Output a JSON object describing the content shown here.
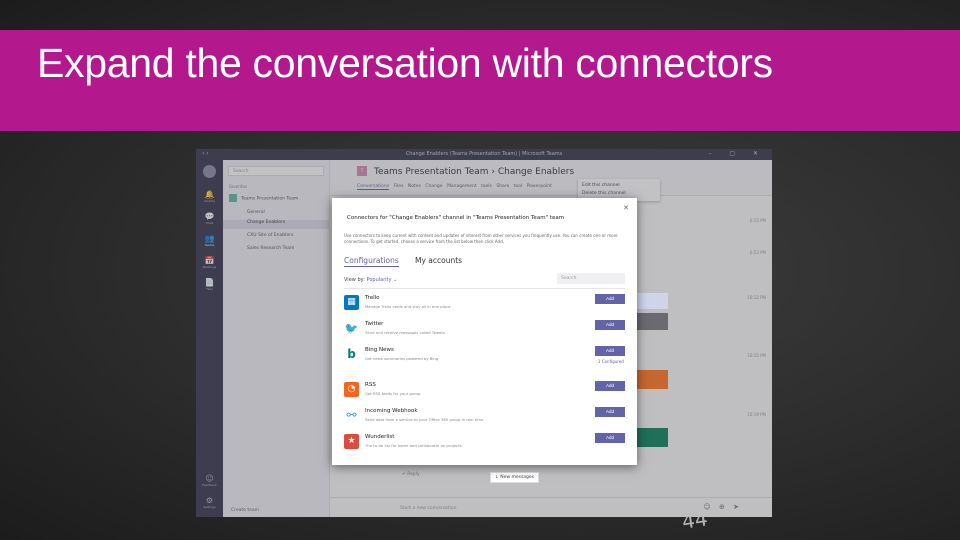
{
  "slide": {
    "title": "Expand the conversation with connectors",
    "chalk_number": "44"
  },
  "window": {
    "title": "Change Enablers (Teams Presentation Team) | Microsoft Teams",
    "nav_glyphs": "‹ ›",
    "controls": "– ▢ ✕"
  },
  "rail": [
    {
      "label": "Activity",
      "icon": "bell-icon",
      "glyph": "🔔"
    },
    {
      "label": "Chat",
      "icon": "chat-icon",
      "glyph": "💬"
    },
    {
      "label": "Teams",
      "icon": "teams-icon",
      "glyph": "👥"
    },
    {
      "label": "Meetings",
      "icon": "calendar-icon",
      "glyph": "📅"
    },
    {
      "label": "Files",
      "icon": "files-icon",
      "glyph": "📄"
    },
    {
      "label": "Feedback",
      "icon": "feedback-icon",
      "glyph": "☺"
    },
    {
      "label": "Settings",
      "icon": "settings-icon",
      "glyph": "⚙"
    }
  ],
  "left_pane": {
    "search_placeholder": "Search",
    "favorites_label": "Favorites",
    "team_name": "Teams Presentation Team",
    "channels": [
      "General",
      "Change Enablers",
      "CXU Site of Enablers",
      "Sales Research Team"
    ],
    "create_team": "Create team"
  },
  "channel": {
    "avatar": "T",
    "breadcrumb": "Teams Presentation Team › Change Enablers",
    "tabs": [
      "Conversations",
      "Files",
      "Notes",
      "Change Management tools",
      "Share tool",
      "Powerpoint"
    ],
    "menu": [
      "Edit this channel",
      "Delete this channel"
    ],
    "timestamps": [
      "6:15 PM",
      "6:53 PM",
      "10:12 PM",
      "10:15 PM",
      "10:19 PM"
    ],
    "reply": "↵ Reply",
    "new_messages": "↓ New messages",
    "composer_placeholder": "Start a new conversation",
    "composer_icons": "☺ ⊕ ➤"
  },
  "dialog": {
    "title": "Connectors for \"Change Enablers\" channel in \"Teams Presentation Team\" team",
    "description": "Use connectors to keep current with content and updates of interest from other services you frequently use. You can create one or more connections. To get started, choose a service from the list below then click Add.",
    "tabs": [
      "Configurations",
      "My accounts"
    ],
    "view_by_label": "View by:",
    "view_by_value": "Popularity",
    "search_placeholder": "Search",
    "close": "✕",
    "connectors": [
      {
        "name": "Trello",
        "desc": "Manage Trello cards and stay all in one place",
        "color": "#0079bf",
        "icon": "trello-icon",
        "glyph": "▦",
        "action": "Add"
      },
      {
        "name": "Twitter",
        "desc": "Send and receive messages called Tweets",
        "color": "#1da1f2",
        "icon": "twitter-icon",
        "glyph": "🐦",
        "action": "Add"
      },
      {
        "name": "Bing News",
        "desc": "Get news summaries powered by Bing",
        "color": "#008373",
        "icon": "bing-icon",
        "glyph": "b",
        "action": "Add",
        "configured": "1 Configured"
      },
      {
        "name": "RSS",
        "desc": "Get RSS feeds for your group",
        "color": "#f26522",
        "icon": "rss-icon",
        "glyph": "◔",
        "action": "Add"
      },
      {
        "name": "Incoming Webhook",
        "desc": "Send data from a service to your Office 365 group in real time",
        "color": "#3a96dd",
        "icon": "webhook-icon",
        "glyph": "⚯",
        "action": "Add"
      },
      {
        "name": "Wunderlist",
        "desc": "The to-do list for home and collaborate on projects",
        "color": "#db4c3f",
        "icon": "wunderlist-icon",
        "glyph": "★",
        "action": "Add"
      }
    ]
  },
  "colors": {
    "slide_band": "#b3188c",
    "teams_purple": "#6264a7",
    "window_dark": "#33344a"
  }
}
